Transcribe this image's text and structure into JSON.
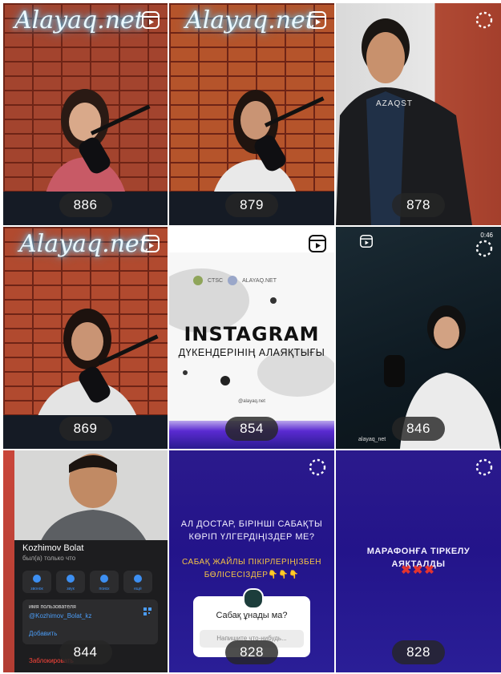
{
  "tiles": [
    {
      "views": "886",
      "neon": "Alayaq.net"
    },
    {
      "views": "879",
      "neon": "Alayaq.net"
    },
    {
      "views": "878",
      "shirt_text": "AZAQST"
    },
    {
      "views": "869",
      "neon": "Alayaq.net"
    },
    {
      "views": "854",
      "logos_text": "CTSC",
      "logos_text2": "ALAYAQ.NET",
      "title": "INSTAGRAM",
      "subtitle": "ДҮКЕНДЕРІНІҢ АЛАЯҚТЫҒЫ",
      "handle": "@alayaq.net"
    },
    {
      "views": "846",
      "timer": "0:46",
      "watermark": "alayaq_net"
    },
    {
      "views": "844",
      "name": "Kozhimov Bolat",
      "status": "был(а) только что",
      "buttons": [
        "звонок",
        "звук",
        "поиск",
        "ещё"
      ],
      "info_label": "имя пользователя",
      "username": "@Kozhimov_Bolat_kz",
      "add": "Добавить",
      "block": "Заблокировать"
    },
    {
      "views": "828",
      "line1": "АЛ ДОСТАР, БІРІНШІ САБАҚТЫ",
      "line2": "КӨРІП ҮЛГЕРДІҢІЗДЕР МЕ?",
      "line3": "САБАҚ ЖАЙЛЫ ПІКІРЛЕРІҢІЗБЕН",
      "line4": "БӨЛІСЕСІЗДЕР👇👇👇",
      "poll_question": "Сабақ ұнады ма?",
      "poll_placeholder": "Напишите что-нибудь..."
    },
    {
      "views": "828",
      "headline": "МАРАФОНҒА ТІРКЕЛУ АЯҚТАЛДЫ",
      "marks": "✖✖✖"
    }
  ],
  "colors": {
    "brick": "#9a3b2a",
    "blue": "#2b1a8c",
    "badge": "#262626"
  },
  "icons": [
    "reels-icon",
    "loading-icon"
  ]
}
